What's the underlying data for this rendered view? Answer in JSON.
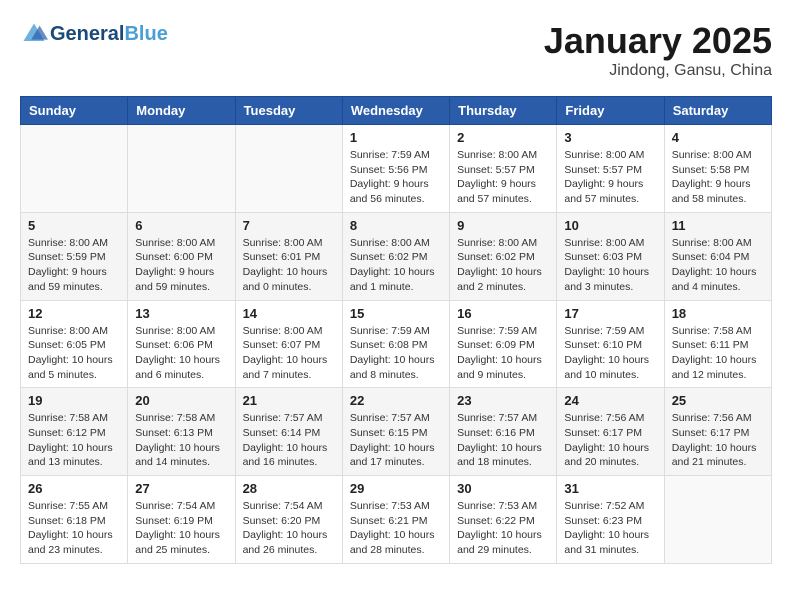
{
  "header": {
    "logo_line1": "General",
    "logo_line2": "Blue",
    "month": "January 2025",
    "location": "Jindong, Gansu, China"
  },
  "weekdays": [
    "Sunday",
    "Monday",
    "Tuesday",
    "Wednesday",
    "Thursday",
    "Friday",
    "Saturday"
  ],
  "weeks": [
    [
      {
        "day": "",
        "info": ""
      },
      {
        "day": "",
        "info": ""
      },
      {
        "day": "",
        "info": ""
      },
      {
        "day": "1",
        "info": "Sunrise: 7:59 AM\nSunset: 5:56 PM\nDaylight: 9 hours\nand 56 minutes."
      },
      {
        "day": "2",
        "info": "Sunrise: 8:00 AM\nSunset: 5:57 PM\nDaylight: 9 hours\nand 57 minutes."
      },
      {
        "day": "3",
        "info": "Sunrise: 8:00 AM\nSunset: 5:57 PM\nDaylight: 9 hours\nand 57 minutes."
      },
      {
        "day": "4",
        "info": "Sunrise: 8:00 AM\nSunset: 5:58 PM\nDaylight: 9 hours\nand 58 minutes."
      }
    ],
    [
      {
        "day": "5",
        "info": "Sunrise: 8:00 AM\nSunset: 5:59 PM\nDaylight: 9 hours\nand 59 minutes."
      },
      {
        "day": "6",
        "info": "Sunrise: 8:00 AM\nSunset: 6:00 PM\nDaylight: 9 hours\nand 59 minutes."
      },
      {
        "day": "7",
        "info": "Sunrise: 8:00 AM\nSunset: 6:01 PM\nDaylight: 10 hours\nand 0 minutes."
      },
      {
        "day": "8",
        "info": "Sunrise: 8:00 AM\nSunset: 6:02 PM\nDaylight: 10 hours\nand 1 minute."
      },
      {
        "day": "9",
        "info": "Sunrise: 8:00 AM\nSunset: 6:02 PM\nDaylight: 10 hours\nand 2 minutes."
      },
      {
        "day": "10",
        "info": "Sunrise: 8:00 AM\nSunset: 6:03 PM\nDaylight: 10 hours\nand 3 minutes."
      },
      {
        "day": "11",
        "info": "Sunrise: 8:00 AM\nSunset: 6:04 PM\nDaylight: 10 hours\nand 4 minutes."
      }
    ],
    [
      {
        "day": "12",
        "info": "Sunrise: 8:00 AM\nSunset: 6:05 PM\nDaylight: 10 hours\nand 5 minutes."
      },
      {
        "day": "13",
        "info": "Sunrise: 8:00 AM\nSunset: 6:06 PM\nDaylight: 10 hours\nand 6 minutes."
      },
      {
        "day": "14",
        "info": "Sunrise: 8:00 AM\nSunset: 6:07 PM\nDaylight: 10 hours\nand 7 minutes."
      },
      {
        "day": "15",
        "info": "Sunrise: 7:59 AM\nSunset: 6:08 PM\nDaylight: 10 hours\nand 8 minutes."
      },
      {
        "day": "16",
        "info": "Sunrise: 7:59 AM\nSunset: 6:09 PM\nDaylight: 10 hours\nand 9 minutes."
      },
      {
        "day": "17",
        "info": "Sunrise: 7:59 AM\nSunset: 6:10 PM\nDaylight: 10 hours\nand 10 minutes."
      },
      {
        "day": "18",
        "info": "Sunrise: 7:58 AM\nSunset: 6:11 PM\nDaylight: 10 hours\nand 12 minutes."
      }
    ],
    [
      {
        "day": "19",
        "info": "Sunrise: 7:58 AM\nSunset: 6:12 PM\nDaylight: 10 hours\nand 13 minutes."
      },
      {
        "day": "20",
        "info": "Sunrise: 7:58 AM\nSunset: 6:13 PM\nDaylight: 10 hours\nand 14 minutes."
      },
      {
        "day": "21",
        "info": "Sunrise: 7:57 AM\nSunset: 6:14 PM\nDaylight: 10 hours\nand 16 minutes."
      },
      {
        "day": "22",
        "info": "Sunrise: 7:57 AM\nSunset: 6:15 PM\nDaylight: 10 hours\nand 17 minutes."
      },
      {
        "day": "23",
        "info": "Sunrise: 7:57 AM\nSunset: 6:16 PM\nDaylight: 10 hours\nand 18 minutes."
      },
      {
        "day": "24",
        "info": "Sunrise: 7:56 AM\nSunset: 6:17 PM\nDaylight: 10 hours\nand 20 minutes."
      },
      {
        "day": "25",
        "info": "Sunrise: 7:56 AM\nSunset: 6:17 PM\nDaylight: 10 hours\nand 21 minutes."
      }
    ],
    [
      {
        "day": "26",
        "info": "Sunrise: 7:55 AM\nSunset: 6:18 PM\nDaylight: 10 hours\nand 23 minutes."
      },
      {
        "day": "27",
        "info": "Sunrise: 7:54 AM\nSunset: 6:19 PM\nDaylight: 10 hours\nand 25 minutes."
      },
      {
        "day": "28",
        "info": "Sunrise: 7:54 AM\nSunset: 6:20 PM\nDaylight: 10 hours\nand 26 minutes."
      },
      {
        "day": "29",
        "info": "Sunrise: 7:53 AM\nSunset: 6:21 PM\nDaylight: 10 hours\nand 28 minutes."
      },
      {
        "day": "30",
        "info": "Sunrise: 7:53 AM\nSunset: 6:22 PM\nDaylight: 10 hours\nand 29 minutes."
      },
      {
        "day": "31",
        "info": "Sunrise: 7:52 AM\nSunset: 6:23 PM\nDaylight: 10 hours\nand 31 minutes."
      },
      {
        "day": "",
        "info": ""
      }
    ]
  ]
}
